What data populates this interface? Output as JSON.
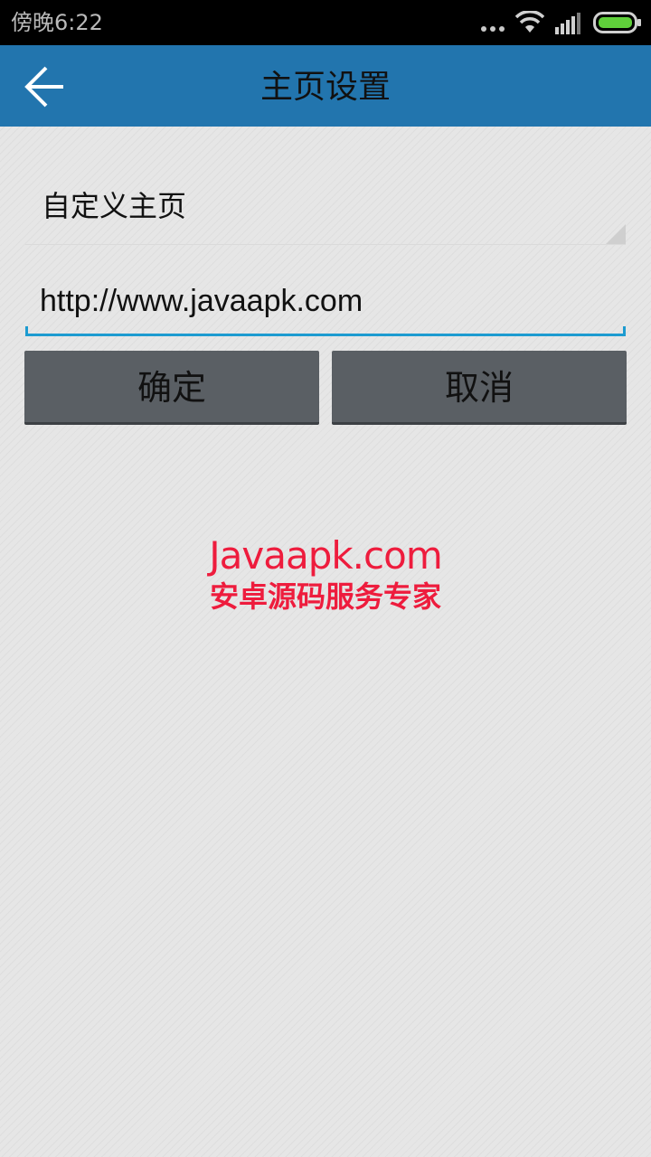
{
  "status_bar": {
    "time": "傍晚6:22",
    "icons": [
      "more-dots-icon",
      "wifi-icon",
      "signal-icon",
      "battery-icon"
    ],
    "battery_color": "#5fd03a"
  },
  "header": {
    "back_icon": "arrow-left-icon",
    "title": "主页设置",
    "background_color": "#2275ae"
  },
  "form": {
    "mode_selected": "自定义主页",
    "url_value": "http://www.javaapk.com",
    "accent_color": "#1d9bd0"
  },
  "buttons": {
    "confirm_label": "确定",
    "cancel_label": "取消"
  },
  "watermark": {
    "line1": "Javaapk.com",
    "line2": "安卓源码服务专家",
    "color": "#ee1c3d"
  }
}
